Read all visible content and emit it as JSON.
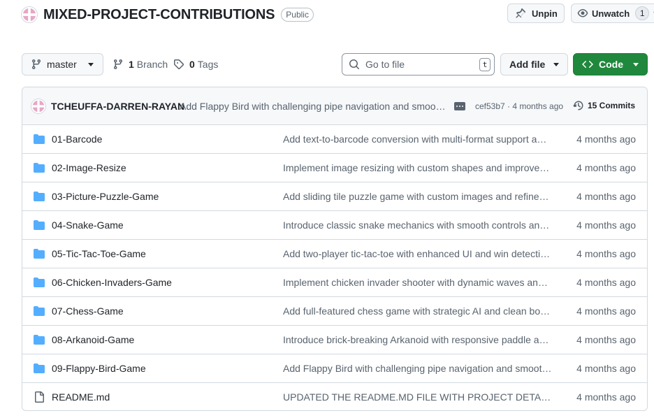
{
  "repo": {
    "name": "MIXED-PROJECT-CONTRIBUTIONS",
    "visibility": "Public"
  },
  "header_actions": {
    "unpin_label": "Unpin",
    "unwatch_label": "Unwatch",
    "watch_count": "1"
  },
  "toolbar": {
    "branch": "master",
    "branches_count": "1",
    "branches_label": "Branch",
    "tags_count": "0",
    "tags_label": "Tags",
    "search_placeholder": "Go to file",
    "search_shortcut": "t",
    "add_file_label": "Add file",
    "code_label": "Code"
  },
  "latest_commit": {
    "author": "TCHEUFFA-DARREN-RAYAN",
    "message": "Add Flappy Bird with challenging pipe navigation and smoo…",
    "sha_time": "cef53b7 · 4 months ago",
    "commits_label": "15 Commits"
  },
  "files": [
    {
      "type": "folder",
      "name": "01-Barcode",
      "message": "Add text-to-barcode conversion with multi-format support a…",
      "date": "4 months ago"
    },
    {
      "type": "folder",
      "name": "02-Image-Resize",
      "message": "Implement image resizing with custom shapes and improve…",
      "date": "4 months ago"
    },
    {
      "type": "folder",
      "name": "03-Picture-Puzzle-Game",
      "message": "Add sliding tile puzzle game with custom images and refine…",
      "date": "4 months ago"
    },
    {
      "type": "folder",
      "name": "04-Snake-Game",
      "message": "Introduce classic snake mechanics with smooth controls and…",
      "date": "4 months ago"
    },
    {
      "type": "folder",
      "name": "05-Tic-Tac-Toe-Game",
      "message": "Add two-player tic-tac-toe with enhanced UI and win detecti…",
      "date": "4 months ago"
    },
    {
      "type": "folder",
      "name": "06-Chicken-Invaders-Game",
      "message": "Implement chicken invader shooter with dynamic waves and…",
      "date": "4 months ago"
    },
    {
      "type": "folder",
      "name": "07-Chess-Game",
      "message": "Add full-featured chess game with strategic AI and clean bo…",
      "date": "4 months ago"
    },
    {
      "type": "folder",
      "name": "08-Arkanoid-Game",
      "message": "Introduce brick-breaking Arkanoid with responsive paddle a…",
      "date": "4 months ago"
    },
    {
      "type": "folder",
      "name": "09-Flappy-Bird-Game",
      "message": "Add Flappy Bird with challenging pipe navigation and smoot…",
      "date": "4 months ago"
    },
    {
      "type": "file",
      "name": "README.md",
      "message": "UPDATED THE README.MD FILE WITH PROJECT DETAILS",
      "date": "4 months ago"
    }
  ],
  "colors": {
    "folder_icon": "#54aeff",
    "code_button": "#1f883d",
    "muted_text": "#59636e",
    "border": "#d1d9e0"
  }
}
